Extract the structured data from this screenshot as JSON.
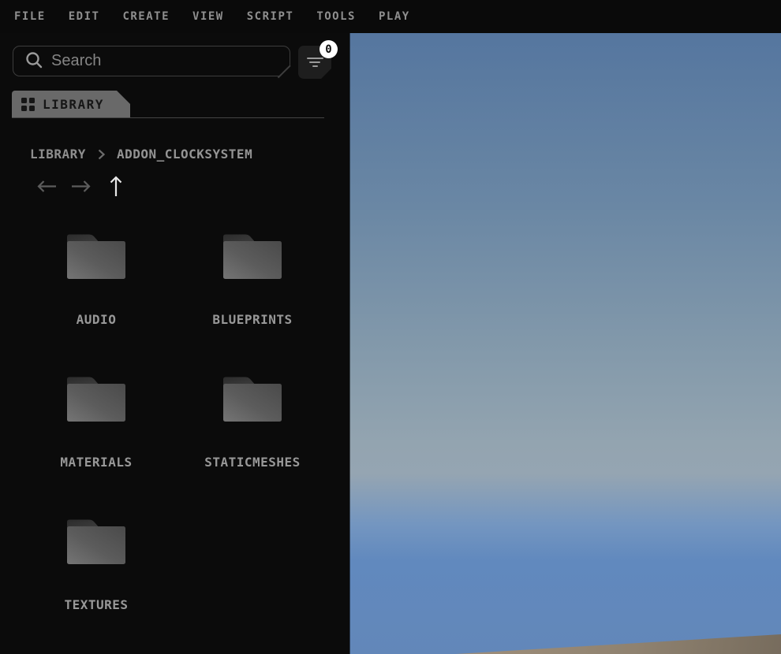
{
  "menu": {
    "items": [
      "FILE",
      "EDIT",
      "CREATE",
      "VIEW",
      "SCRIPT",
      "TOOLS",
      "PLAY"
    ]
  },
  "asset_browser": {
    "search": {
      "placeholder": "Search",
      "value": ""
    },
    "filter": {
      "badge_count": "0"
    },
    "tab": {
      "label": "LIBRARY"
    },
    "breadcrumb": {
      "segments": [
        "LIBRARY",
        "ADDON_CLOCKSYSTEM"
      ]
    },
    "folders": [
      {
        "name": "AUDIO"
      },
      {
        "name": "BLUEPRINTS"
      },
      {
        "name": "MATERIALS"
      },
      {
        "name": "STATICMESHES"
      },
      {
        "name": "TEXTURES"
      }
    ]
  },
  "icons": {
    "search": "magnifier-icon",
    "filter": "funnel-icon",
    "tab": "grid-icon",
    "nav": [
      "arrow-left-icon",
      "arrow-right-icon",
      "arrow-up-icon"
    ],
    "folder": "folder-icon"
  },
  "colors": {
    "panel_bg": "#0b0b0b",
    "menubar_bg": "#0a0a0a",
    "menu_text": "#8f8f8f",
    "tab_bg": "#696969",
    "badge_bg": "#ffffff",
    "sky_top": "#55769f",
    "sky_haze": "#95a5b2",
    "sky_bottom": "#6287b9",
    "floor": "#8f8270"
  }
}
